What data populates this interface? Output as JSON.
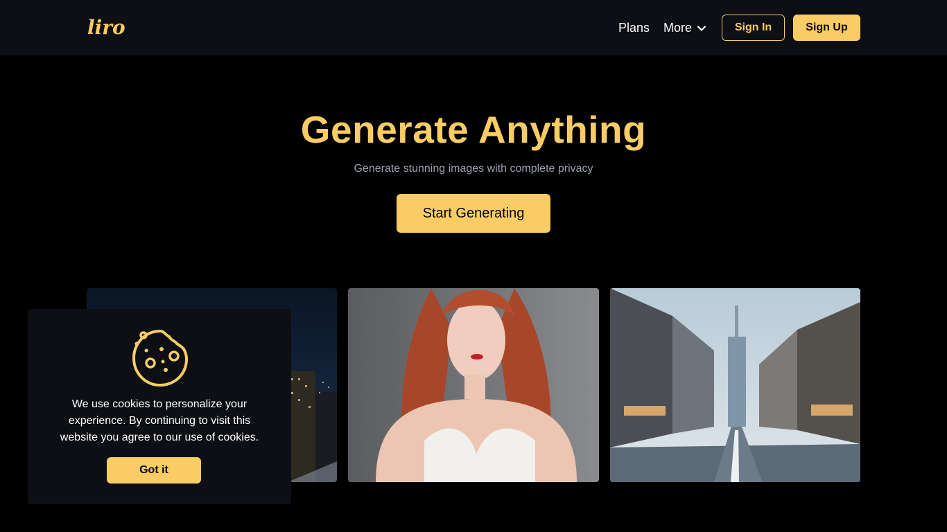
{
  "header": {
    "logo_text": "liro",
    "nav": {
      "plans_label": "Plans",
      "more_label": "More"
    },
    "sign_in_label": "Sign In",
    "sign_up_label": "Sign Up"
  },
  "hero": {
    "title": "Generate Anything",
    "subtitle": "Generate stunning images with complete privacy",
    "cta_label": "Start Generating"
  },
  "gallery": {
    "images": [
      {
        "icon": "night-city-skyline-image"
      },
      {
        "icon": "redhead-woman-portrait-image"
      },
      {
        "icon": "empty-city-street-image"
      }
    ]
  },
  "cookie_banner": {
    "icon": "cookie-icon",
    "message": "We use cookies to personalize your experience. By continuing to visit this website you agree to our use of cookies.",
    "accept_label": "Got it"
  },
  "colors": {
    "accent": "#f9cc65",
    "background": "#000000",
    "header_bg": "#0d0f14",
    "muted_text": "#9ca3af"
  }
}
